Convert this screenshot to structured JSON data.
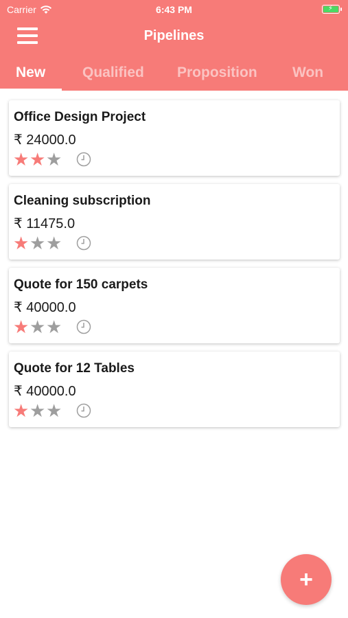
{
  "status_bar": {
    "carrier": "Carrier",
    "time": "6:43 PM",
    "icons": [
      "wifi-icon",
      "battery-icon"
    ]
  },
  "nav": {
    "title": "Pipelines",
    "menu_icon": "hamburger-menu-icon"
  },
  "tabs": [
    {
      "label": "New",
      "active": true
    },
    {
      "label": "Qualified",
      "active": false
    },
    {
      "label": "Proposition",
      "active": false
    },
    {
      "label": "Won",
      "active": false
    }
  ],
  "opportunities": [
    {
      "title": "Office Design Project",
      "amount": "₹ 24000.0",
      "stars": "2 of 3"
    },
    {
      "title": "Cleaning subscription",
      "amount": "₹ 11475.0",
      "stars": "1 of 3"
    },
    {
      "title": "Quote for 150 carpets",
      "amount": "₹ 40000.0",
      "stars": "1 of 3"
    },
    {
      "title": "Quote for 12 Tables",
      "amount": "₹ 40000.0",
      "stars": "1 of 3"
    }
  ],
  "fab": {
    "label": "+"
  },
  "colors": {
    "accent": "#f77b78",
    "star_off": "#9e9e9e",
    "battery": "#4cd964"
  }
}
